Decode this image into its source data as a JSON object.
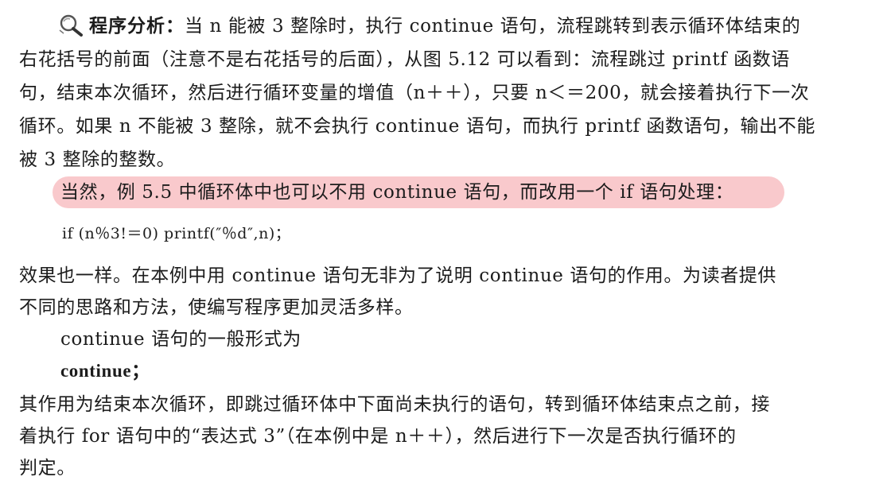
{
  "analysis": {
    "icon": "magnifier-icon",
    "label": "程序分析：",
    "line1": "当 n 能被 3 整除时，执行 continue 语句，流程跳转到表示循环体结束的",
    "line2": "右花括号的前面（注意不是右花括号的后面），从图 5.12 可以看到：流程跳过 printf 函数语",
    "line3": "句，结束本次循环，然后进行循环变量的增值（n＋＋），只要 n＜＝200，就会接着执行下一次",
    "line4": "循环。如果 n 不能被 3 整除，就不会执行 continue 语句，而执行 printf 函数语句，输出不能",
    "line5": "被 3 整除的整数。"
  },
  "highlighted_sentence": "当然，例 5.5 中循环体中也可以不用 continue 语句，而改用一个 if 语句处理：",
  "highlight_color": "#f9c9cc",
  "code_line": "if (n％3!＝0) printf(″％d″,n)；",
  "effect": {
    "line1": "效果也一样。在本例中用 continue 语句无非为了说明 continue 语句的作用。为读者提供",
    "line2": "不同的思路和方法，使编写程序更加灵活多样。"
  },
  "general_form_intro": "continue 语句的一般形式为",
  "keyword": "continue；",
  "purpose": {
    "line1": "其作用为结束本次循环，即跳过循环体中下面尚未执行的语句，转到循环体结束点之前，接",
    "line2": "着执行 for 语句中的“表达式 3”（在本例中是 n＋＋），然后进行下一次是否执行循环的",
    "line3": "判定。"
  }
}
